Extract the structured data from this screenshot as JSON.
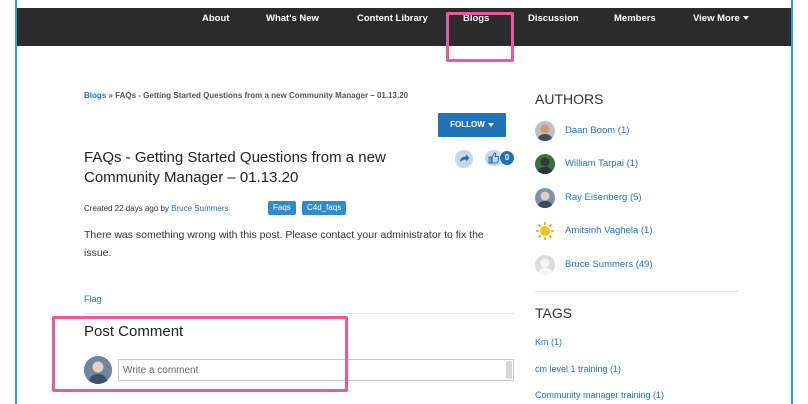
{
  "nav": {
    "items": [
      {
        "label": "About"
      },
      {
        "label": "What's New"
      },
      {
        "label": "Content Library"
      },
      {
        "label": "Blogs"
      },
      {
        "label": "Discussion"
      },
      {
        "label": "Members"
      },
      {
        "label": "View More"
      }
    ],
    "active": "Blogs"
  },
  "breadcrumb": {
    "root": "Blogs",
    "separator": " » ",
    "current": "FAQs - Getting Started Questions from a new Community Manager – 01.13.20"
  },
  "post": {
    "follow_label": "FOLLOW",
    "title": "FAQs - Getting Started Questions from a new Community Manager – 01.13.20",
    "like_count": "0",
    "created_text": "Created 22 days ago by ",
    "author": "Bruce Summers",
    "tags": [
      "Faqs",
      "C4d_faqs"
    ],
    "message": "There was something wrong with this post. Please contact your administrator to fix the issue.",
    "flag_label": "Flag"
  },
  "comment": {
    "heading": "Post Comment",
    "placeholder": "Write a comment"
  },
  "sidebar": {
    "authors_heading": "AUTHORS",
    "authors": [
      {
        "name": "Daan Boom (1)",
        "avatar": "photo"
      },
      {
        "name": "William Tarpai (1)",
        "avatar": "photo"
      },
      {
        "name": "Ray Eisenberg (5)",
        "avatar": "photo"
      },
      {
        "name": "Amitsinh Vaghela (1)",
        "avatar": "sun-icon"
      },
      {
        "name": "Bruce Summers (49)",
        "avatar": "default-user-icon"
      }
    ],
    "tags_heading": "TAGS",
    "tags": [
      "Km (1)",
      "cm level 1 training (1)",
      "Community manager training (1)"
    ]
  },
  "colors": {
    "nav_bg": "#2b2b2b",
    "link": "#1f73b7",
    "highlight": "#e85a9b",
    "frame_border": "#2aa3d8"
  }
}
